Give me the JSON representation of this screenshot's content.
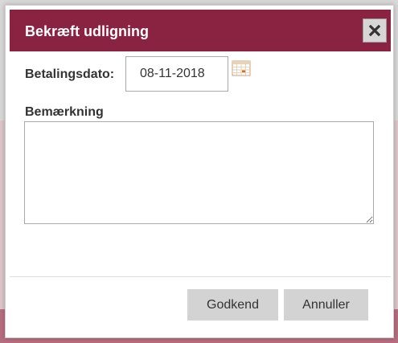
{
  "dialog": {
    "title": "Bekræft udligning",
    "close_icon": "close-icon",
    "payment_date_label": "Betalingsdato:",
    "payment_date_value": "08-11-2018",
    "calendar_icon": "calendar-icon",
    "note_label": "Bemærkning",
    "note_value": "",
    "confirm_label": "Godkend",
    "cancel_label": "Annuller"
  },
  "colors": {
    "titlebar": "#8a2342",
    "button_bg": "#d3d3d3"
  }
}
